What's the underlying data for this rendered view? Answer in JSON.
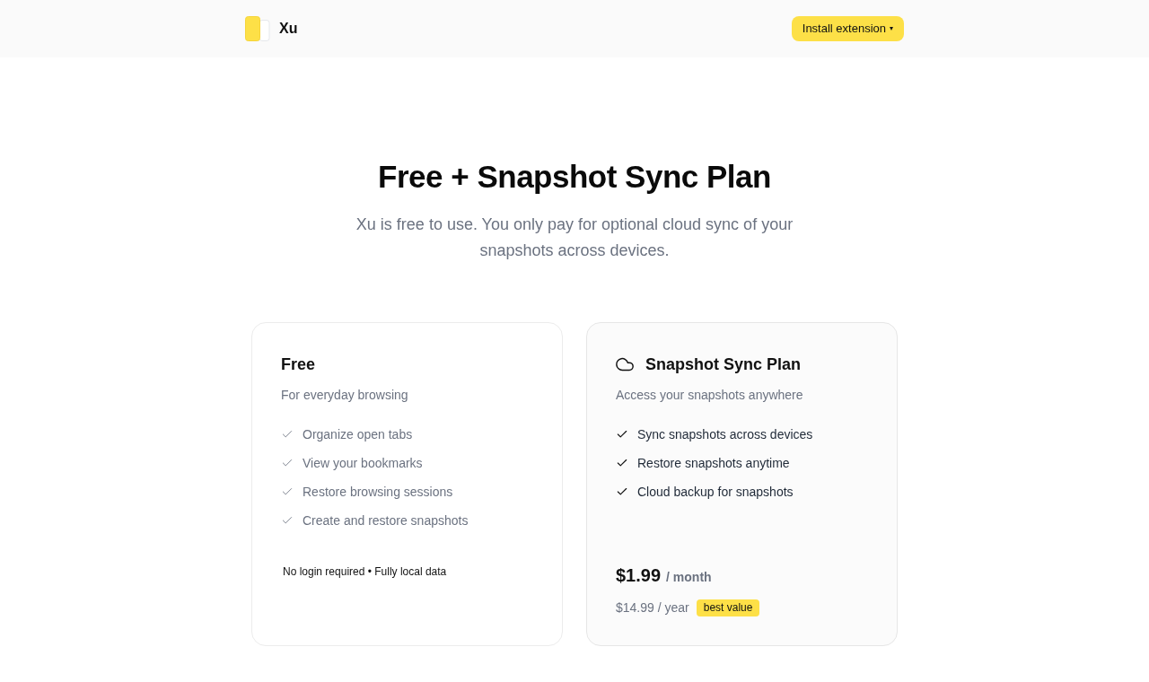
{
  "header": {
    "brand": "Xu",
    "install_button": {
      "label": "Install extension",
      "caret": "▾"
    }
  },
  "hero": {
    "title": "Free + Snapshot Sync Plan",
    "subtitle": "Xu is free to use. You only pay for optional cloud sync of your snapshots across devices."
  },
  "plans": [
    {
      "kind": "free",
      "name": "Free",
      "tagline": "For everyday browsing",
      "features": [
        "Organize open tabs",
        "View your bookmarks",
        "Restore browsing sessions",
        "Create and restore snapshots"
      ],
      "note": "No login required • Fully local data"
    },
    {
      "kind": "paid",
      "name": "Snapshot Sync Plan",
      "tagline": "Access your snapshots anywhere",
      "features": [
        "Sync snapshots across devices",
        "Restore snapshots anytime",
        "Cloud backup for snapshots"
      ],
      "price": {
        "amount": "$1.99",
        "period": "/ month",
        "yearly": "$14.99 / year",
        "badge": "best value"
      }
    }
  ]
}
